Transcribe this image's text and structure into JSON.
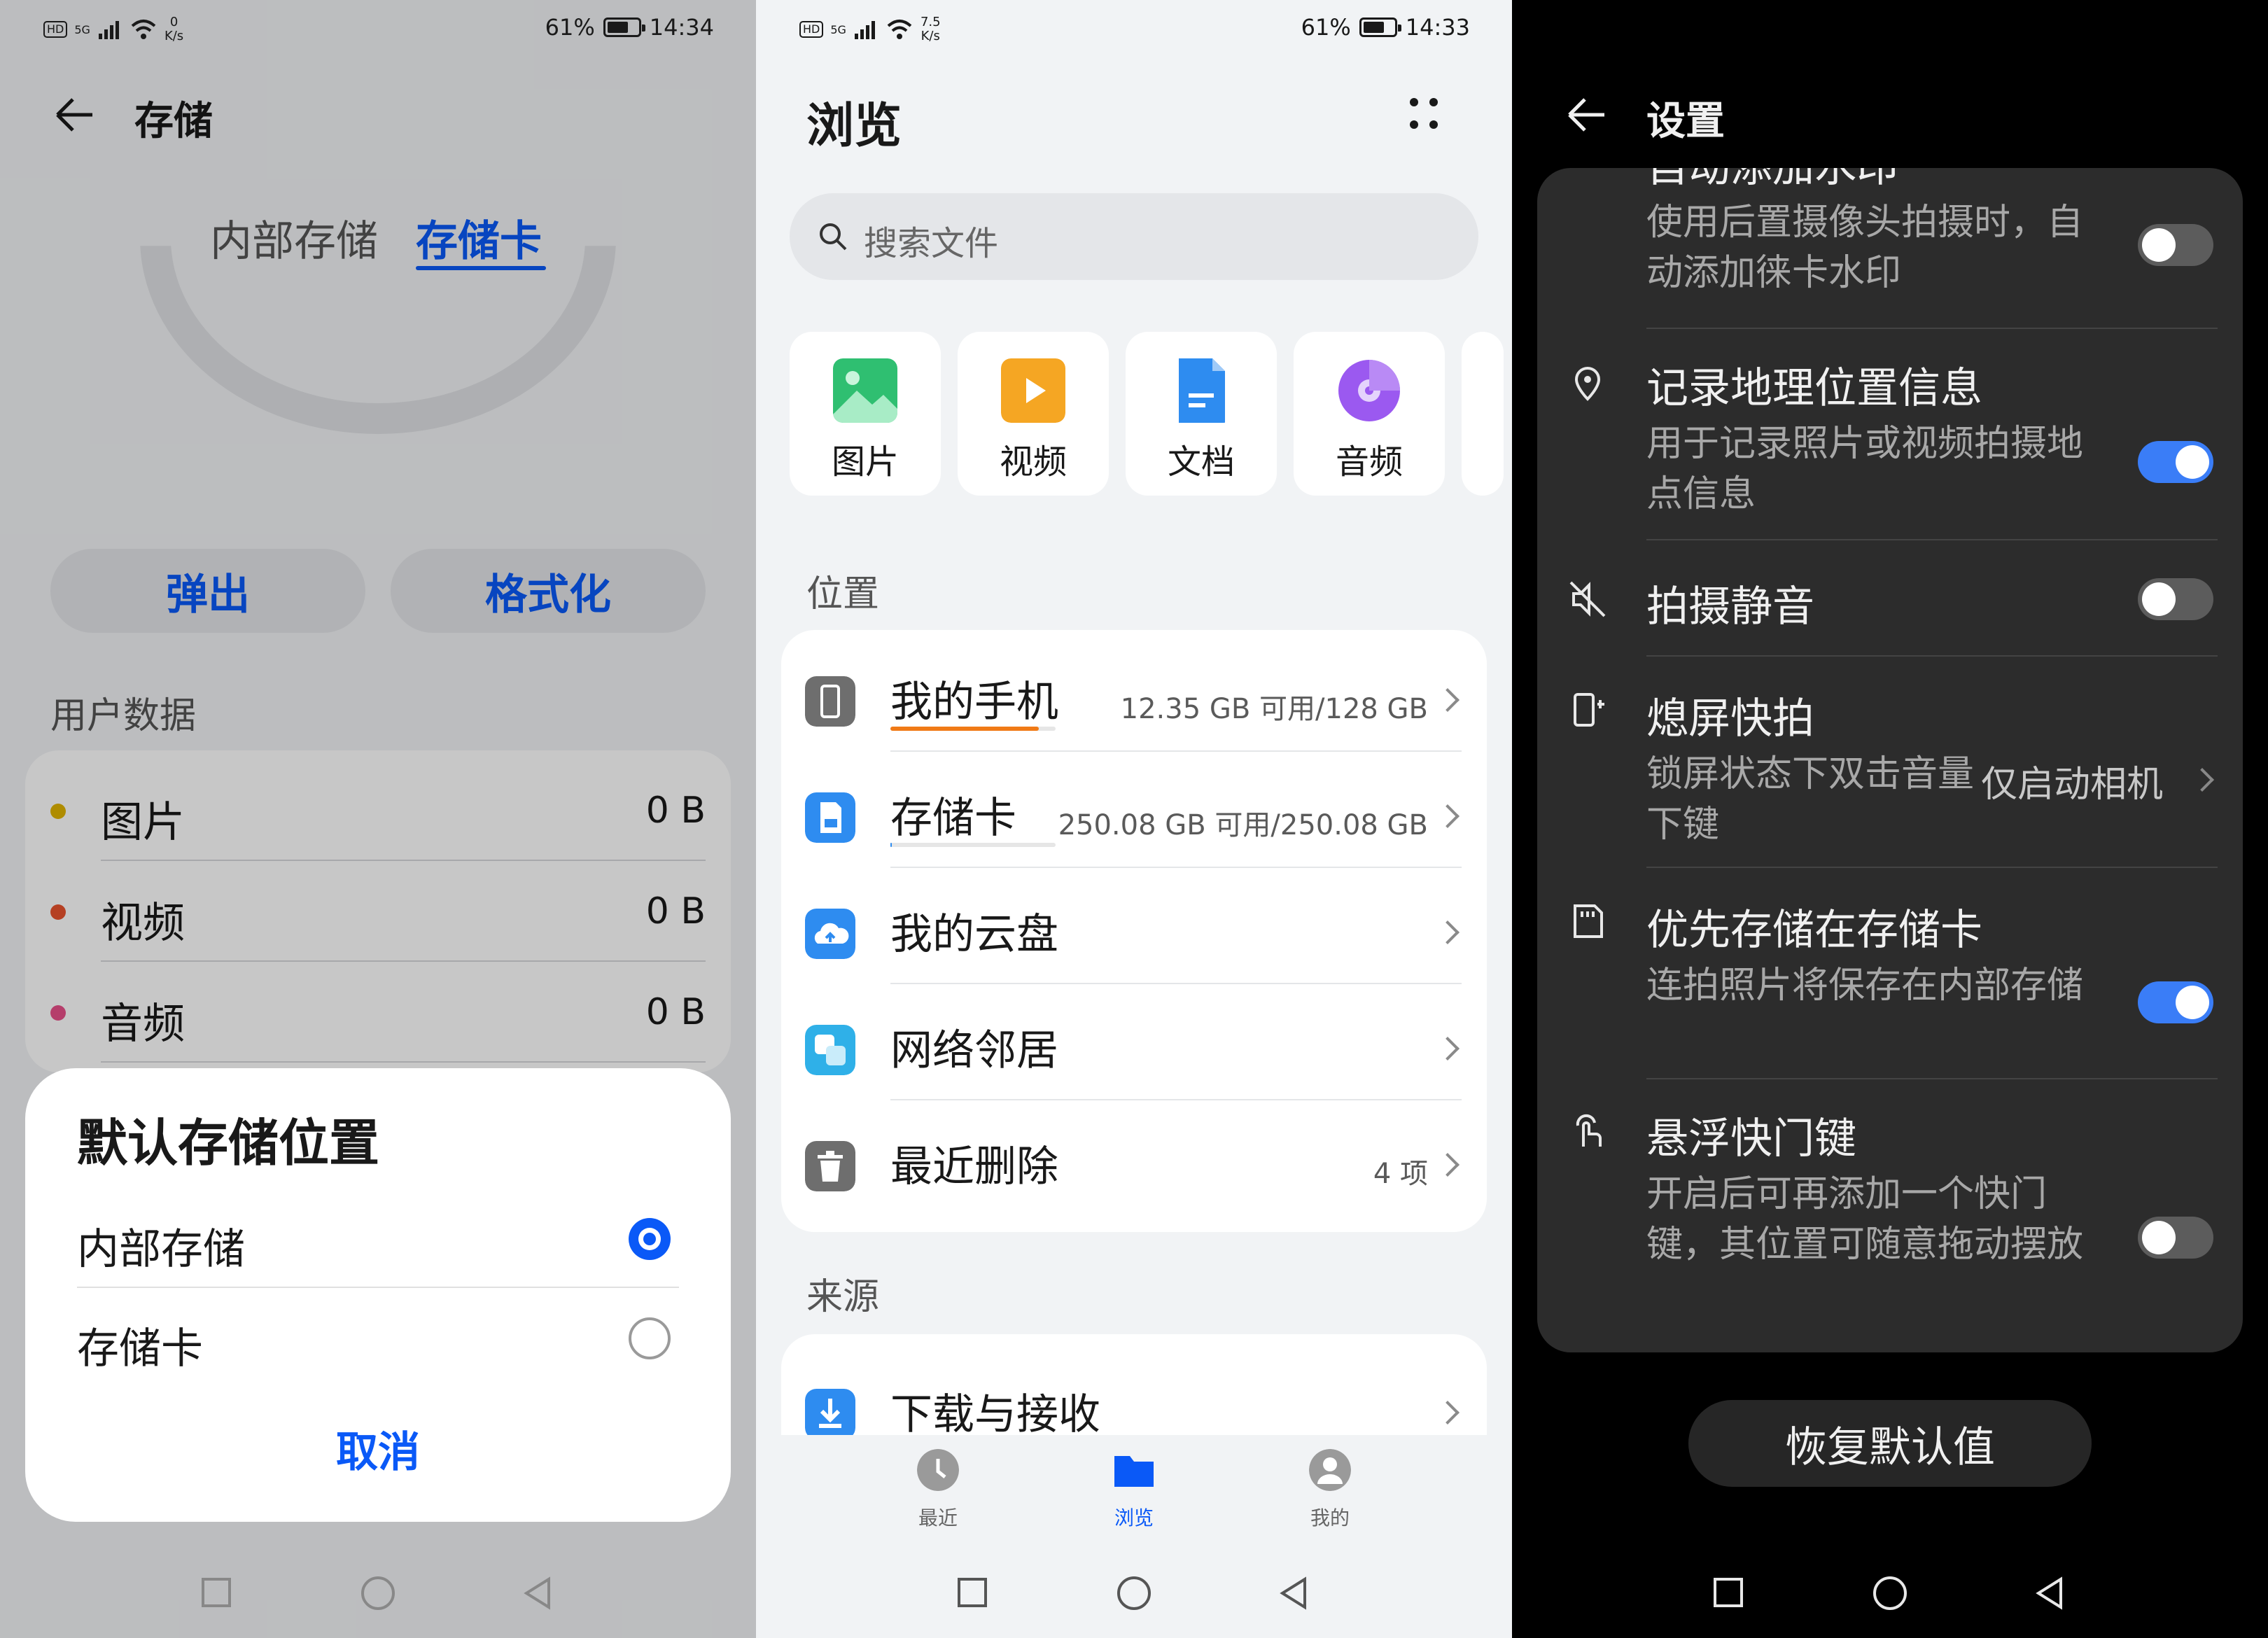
{
  "panel1": {
    "status": {
      "network": "5G",
      "speed_value": "0",
      "speed_unit": "K/s",
      "battery": "61%",
      "time": "14:34"
    },
    "title": "存储",
    "tabs": [
      "内部存储",
      "存储卡"
    ],
    "buttons": {
      "eject": "弹出",
      "format": "格式化"
    },
    "section_label": "用户数据",
    "user_data": [
      {
        "label": "图片",
        "value": "0 B",
        "color": "#e0b400"
      },
      {
        "label": "视频",
        "value": "0 B",
        "color": "#e8532e"
      },
      {
        "label": "音频",
        "value": "0 B",
        "color": "#e8508a"
      }
    ],
    "dialog": {
      "title": "默认存储位置",
      "options": [
        {
          "label": "内部存储",
          "selected": true
        },
        {
          "label": "存储卡",
          "selected": false
        }
      ],
      "cancel": "取消"
    }
  },
  "panel2": {
    "status": {
      "network": "5G",
      "speed_value": "7.5",
      "speed_unit": "K/s",
      "battery": "61%",
      "time": "14:33"
    },
    "title": "浏览",
    "search_placeholder": "搜索文件",
    "categories": [
      {
        "label": "图片",
        "icon": "image-icon",
        "color": "#2fbf71"
      },
      {
        "label": "视频",
        "icon": "video-icon",
        "color": "#f5a623"
      },
      {
        "label": "文档",
        "icon": "document-icon",
        "color": "#2e8cf0"
      },
      {
        "label": "音频",
        "icon": "audio-icon",
        "color": "#9b59f0"
      }
    ],
    "location_label": "位置",
    "locations": [
      {
        "label": "我的手机",
        "info": "12.35 GB 可用/128 GB",
        "icon": "phone-icon",
        "color": "#6e6e6e",
        "usage": 0.9
      },
      {
        "label": "存储卡",
        "info": "250.08 GB 可用/250.08 GB",
        "icon": "sdcard-icon",
        "color": "#2e8cf0",
        "usage": 0.0
      },
      {
        "label": "我的云盘",
        "info": "",
        "icon": "cloud-icon",
        "color": "#2e8cf0"
      },
      {
        "label": "网络邻居",
        "info": "",
        "icon": "network-icon",
        "color": "#2fb0e8"
      },
      {
        "label": "最近删除",
        "info": "4 项",
        "icon": "trash-icon",
        "color": "#6e6e6e"
      }
    ],
    "source_label": "来源",
    "sources": [
      {
        "label": "下载与接收",
        "icon": "download-icon",
        "color": "#2e8cf0"
      }
    ],
    "bottom_tabs": [
      {
        "label": "最近",
        "active": false
      },
      {
        "label": "浏览",
        "active": true
      },
      {
        "label": "我的",
        "active": false
      }
    ],
    "accent": "#0a59f7"
  },
  "panel3": {
    "title": "设置",
    "partial_item": {
      "title": "自动添加水印",
      "subtitle": "使用后置摄像头拍摄时，自动添加徕卡水印",
      "on": false
    },
    "items": [
      {
        "title": "记录地理位置信息",
        "subtitle": "用于记录照片或视频拍摄地点信息",
        "on": true,
        "icon": "location-icon"
      },
      {
        "title": "拍摄静音",
        "subtitle": "",
        "on": false,
        "icon": "mute-icon"
      },
      {
        "title": "熄屏快拍",
        "subtitle": "锁屏状态下双击音量下键",
        "value": "仅启动相机",
        "icon": "quick-snap-icon"
      },
      {
        "title": "优先存储在存储卡",
        "subtitle": "连拍照片将保存在内部存储",
        "on": true,
        "icon": "sdcard-icon"
      },
      {
        "title": "悬浮快门键",
        "subtitle": "开启后可再添加一个快门键，其位置可随意拖动摆放",
        "on": false,
        "icon": "touch-icon"
      }
    ],
    "restore_button": "恢复默认值"
  }
}
